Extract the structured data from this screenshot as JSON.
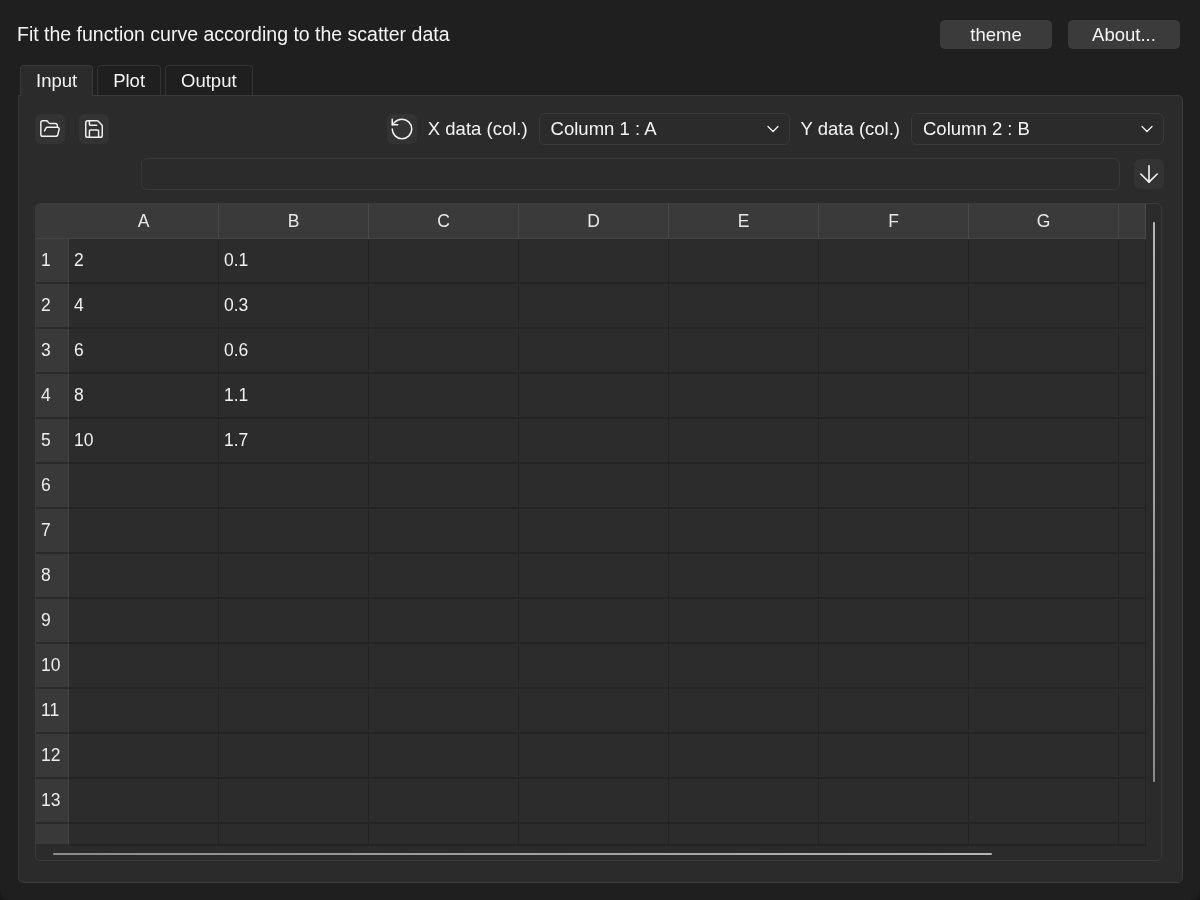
{
  "window": {
    "title": "Fit the function curve according to the scatter data"
  },
  "header_buttons": [
    "theme",
    "About..."
  ],
  "tabs": [
    {
      "label": "Input",
      "selected": true
    },
    {
      "label": "Plot",
      "selected": false
    },
    {
      "label": "Output",
      "selected": false
    }
  ],
  "toolbar": {
    "x_label": "X data (col.)",
    "x_select": "Column 1 : A",
    "y_label": "Y data (col.)",
    "y_select": "Column 2 : B"
  },
  "table": {
    "columns": [
      "A",
      "B",
      "C",
      "D",
      "E",
      "F",
      "G"
    ],
    "rows": [
      {
        "header": "1",
        "cells": [
          "2",
          "0.1"
        ]
      },
      {
        "header": "2",
        "cells": [
          "4",
          "0.3"
        ]
      },
      {
        "header": "3",
        "cells": [
          "6",
          "0.6"
        ]
      },
      {
        "header": "4",
        "cells": [
          "8",
          "1.1"
        ]
      },
      {
        "header": "5",
        "cells": [
          "10",
          "1.7"
        ]
      },
      {
        "header": "6"
      },
      {
        "header": "7"
      },
      {
        "header": "8"
      },
      {
        "header": "9"
      },
      {
        "header": "10"
      },
      {
        "header": "11"
      },
      {
        "header": "12"
      },
      {
        "header": "13"
      }
    ]
  }
}
